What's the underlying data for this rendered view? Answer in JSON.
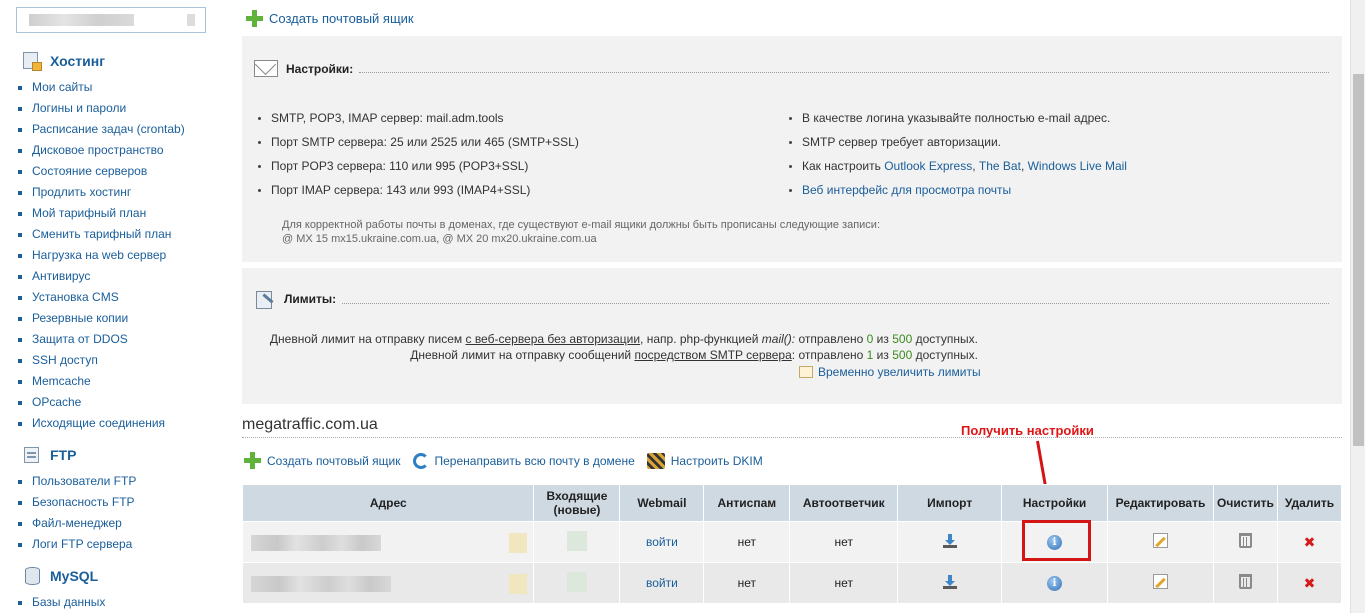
{
  "sidebar": {
    "sections": [
      {
        "title": "Хостинг",
        "items": [
          "Мои сайты",
          "Логины и пароли",
          "Расписание задач (crontab)",
          "Дисковое пространство",
          "Состояние серверов",
          "Продлить хостинг",
          "Мой тарифный план",
          "Сменить тарифный план",
          "Нагрузка на web сервер",
          "Антивирус",
          "Установка CMS",
          "Резервные копии",
          "Защита от DDOS",
          "SSH доступ",
          "Memcache",
          "OPcache",
          "Исходящие соединения"
        ]
      },
      {
        "title": "FTP",
        "items": [
          "Пользователи FTP",
          "Безопасность FTP",
          "Файл-менеджер",
          "Логи FTP сервера"
        ]
      },
      {
        "title": "MySQL",
        "items": [
          "Базы данных"
        ]
      }
    ]
  },
  "top": {
    "create_mailbox": "Создать почтовый ящик"
  },
  "settings": {
    "title": "Настройки:",
    "left": [
      "SMTP, POP3, IMAP сервер: mail.adm.tools",
      "Порт SMTP сервера: 25 или 2525 или 465 (SMTP+SSL)",
      "Порт POP3 сервера: 110 или 995 (POP3+SSL)",
      "Порт IMAP сервера: 143 или 993 (IMAP4+SSL)"
    ],
    "right1": "В качестве логина указывайте полностью e-mail адрес.",
    "right2": "SMTP сервер требует авторизации.",
    "right3_prefix": "Как настроить",
    "right3_links": [
      "Outlook Express",
      "The Bat",
      "Windows Live Mail"
    ],
    "right4_link": "Веб интерфейс для просмотра почты",
    "note_line1": "Для корректной работы почты в доменах, где существуют e-mail ящики должны быть прописаны следующие записи:",
    "note_line2": "@  MX  15  mx15.ukraine.com.ua, @  MX  20  mx20.ukraine.com.ua"
  },
  "limits": {
    "title": "Лимиты:",
    "row1": {
      "a": "Дневной лимит на отправку писем",
      "u": "с веб-сервера без авторизации",
      "b": ", напр. php-функцией",
      "i": "mail():",
      "c": "отправлено",
      "sent": "0",
      "d": "из",
      "total": "500",
      "e": "доступных."
    },
    "row2": {
      "a": "Дневной лимит на отправку сообщений",
      "u": "посредством SMTP сервера",
      "b": ":",
      "c": "отправлено",
      "sent": "1",
      "d": "из",
      "total": "500",
      "e": "доступных."
    },
    "raise_link": "Временно увеличить лимиты"
  },
  "domain": {
    "name": "megatraffic.com.ua",
    "actions": {
      "create": "Создать почтовый ящик",
      "redirect": "Перенаправить всю почту в домене",
      "dkim": "Настроить DKIM"
    }
  },
  "callout": "Получить настройки",
  "table": {
    "headers": {
      "address": "Адрес",
      "incoming": "Входящие",
      "incoming_sub": "(новые)",
      "webmail": "Webmail",
      "antispam": "Антиспам",
      "autoreply": "Автоответчик",
      "import": "Импорт",
      "settings": "Настройки",
      "edit": "Редактировать",
      "clear": "Очистить",
      "delete": "Удалить"
    },
    "rows": [
      {
        "webmail": "войти",
        "antispam": "нет",
        "autoreply": "нет"
      },
      {
        "webmail": "войти",
        "antispam": "нет",
        "autoreply": "нет"
      }
    ]
  },
  "icons": {
    "info": "i",
    "delete": "✖"
  }
}
